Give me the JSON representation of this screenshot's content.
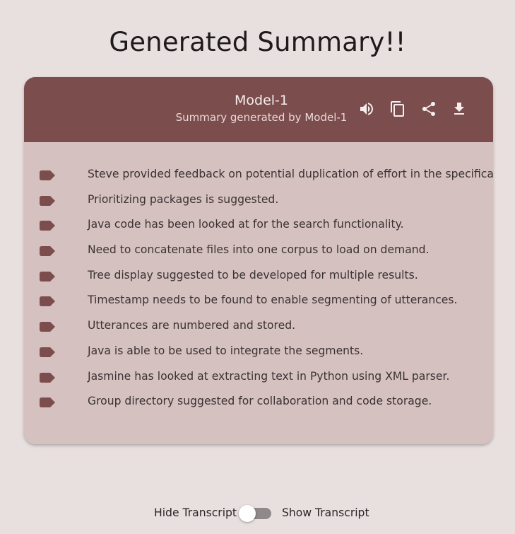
{
  "page": {
    "title": "Generated Summary!!"
  },
  "card": {
    "model_name": "Model-1",
    "model_subtitle": "Summary generated by Model-1",
    "header_color": "#7b4d4d",
    "body_color": "#d6c1c1",
    "actions": [
      {
        "icon": "volume-up-icon"
      },
      {
        "icon": "copy-icon"
      },
      {
        "icon": "share-icon"
      },
      {
        "icon": "download-icon"
      }
    ],
    "bullet_icon": "label-tag-icon",
    "items": [
      "Steve provided feedback on potential duplication of effort in the specification.",
      "Prioritizing packages is suggested.",
      "Java code has been looked at for the search functionality.",
      "Need to concatenate files into one corpus to load on demand.",
      "Tree display suggested to be developed for multiple results.",
      "Timestamp needs to be found to enable segmenting of utterances.",
      "Utterances are numbered and stored.",
      "Java is able to be used to integrate the segments.",
      "Jasmine has looked at extracting text in Python using XML parser.",
      "Group directory suggested for collaboration and code storage."
    ]
  },
  "transcript_toggle": {
    "left_label": "Hide Transcript",
    "right_label": "Show Transcript",
    "state": "hide"
  }
}
